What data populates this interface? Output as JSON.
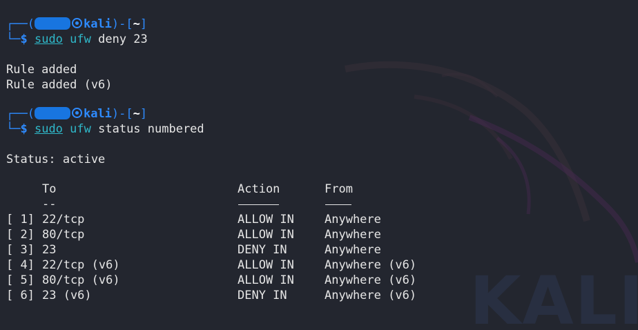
{
  "prompts": [
    {
      "host": "kali",
      "dir": "~",
      "sudo": "sudo",
      "bin": "ufw",
      "args": " deny 23"
    },
    {
      "host": "kali",
      "dir": "~",
      "sudo": "sudo",
      "bin": "ufw",
      "args": " status numbered"
    }
  ],
  "output1": [
    "Rule added",
    "Rule added (v6)"
  ],
  "status_line": "Status: active",
  "table": {
    "headers": {
      "to": "To",
      "action": "Action",
      "from": "From"
    },
    "underline_to": "--",
    "rows": [
      {
        "num": "[ 1]",
        "to": "22/tcp",
        "action": "ALLOW IN",
        "from": "Anywhere"
      },
      {
        "num": "[ 2]",
        "to": "80/tcp",
        "action": "ALLOW IN",
        "from": "Anywhere"
      },
      {
        "num": "[ 3]",
        "to": "23",
        "action": "DENY IN",
        "from": "Anywhere"
      },
      {
        "num": "[ 4]",
        "to": "22/tcp (v6)",
        "action": "ALLOW IN",
        "from": "Anywhere (v6)"
      },
      {
        "num": "[ 5]",
        "to": "80/tcp (v6)",
        "action": "ALLOW IN",
        "from": "Anywhere (v6)"
      },
      {
        "num": "[ 6]",
        "to": "23 (v6)",
        "action": "DENY IN",
        "from": "Anywhere (v6)"
      }
    ]
  },
  "wallpaper_text": "KALI",
  "colors": {
    "background": "#23262f",
    "prompt_blue": "#2e8bff",
    "command_cyan": "#2fb8c9",
    "text": "#e6e6e6",
    "redaction": "#1875e0"
  }
}
